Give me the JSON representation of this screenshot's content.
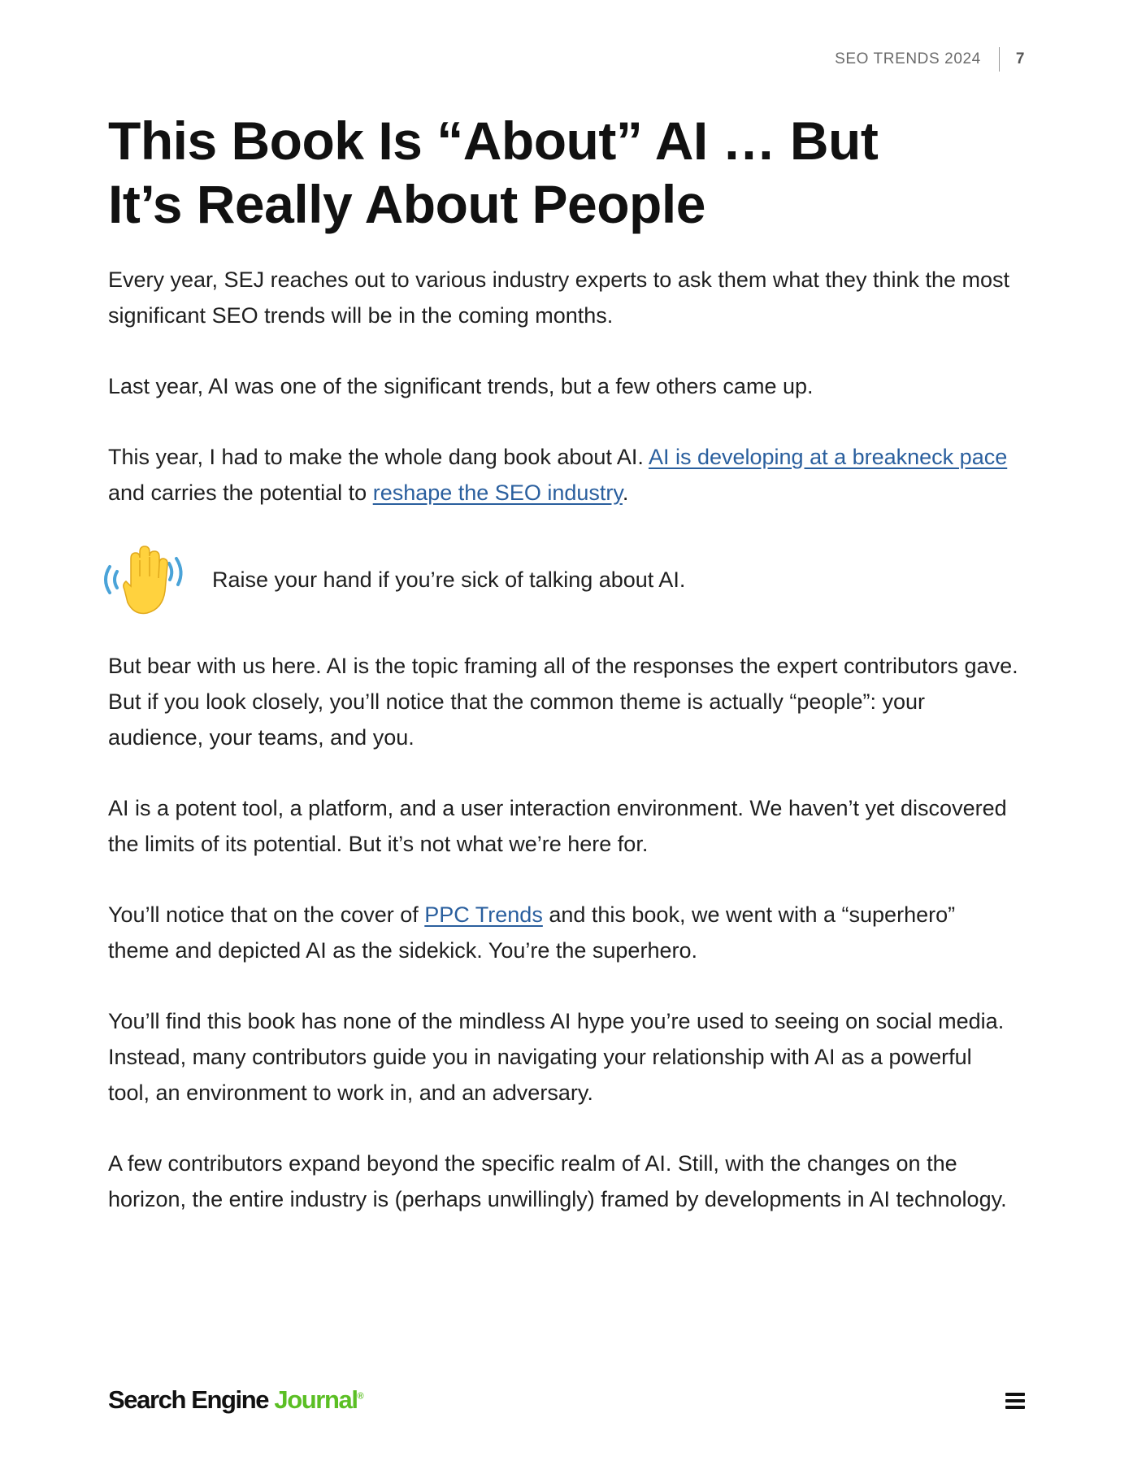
{
  "header": {
    "section_label": "SEO TRENDS 2024",
    "page_number": "7"
  },
  "title": {
    "line1": "This Book Is “About” AI … But",
    "line2": "It’s Really About People"
  },
  "paragraphs": {
    "p1": "Every year, SEJ reaches out to various industry experts to ask them what they think the most significant SEO trends will be in the coming months.",
    "p2": "Last year, AI was one of the significant trends, but a few others came up.",
    "p3": {
      "part1": "This year, I had to make the whole dang book about AI. ",
      "link1": "AI is developing at a breakneck pace",
      "part2": " and carries the potential to ",
      "link2": "reshape the SEO industry",
      "part3": "."
    },
    "callout": {
      "icon": "raised-hand-emoji",
      "text": "Raise your hand if you’re sick of talking about AI."
    },
    "p4": "But bear with us here. AI is the topic framing all of the responses the expert contributors gave. But if you look closely, you’ll notice that the common theme is actually “people”: your audience, your teams, and you.",
    "p5": "AI is a potent tool, a platform, and a user interaction environment. We haven’t yet discovered the limits of its potential. But it’s not what we’re here for.",
    "p6": {
      "part1": "You’ll notice that on the cover of ",
      "link1": "PPC Trends",
      "part2": " and this book, we went with a “superhero” theme and depicted AI as the sidekick. You’re the superhero."
    },
    "p7": "You’ll find this book has none of the mindless AI hype you’re used to seeing on social media. Instead, many contributors guide you in navigating your relationship with AI as a powerful tool, an environment to work in, and an adversary.",
    "p8": "A few contributors expand beyond the specific realm of AI. Still, with the changes on the horizon, the entire industry is (perhaps unwillingly) framed by developments in AI technology."
  },
  "footer": {
    "logo_part1": "Search Engine ",
    "logo_part2": "Journal",
    "logo_reg": "®",
    "menu_icon": "hamburger-menu-icon"
  },
  "colors": {
    "link": "#2a5f9e",
    "brand_green": "#5bbf24",
    "text": "#1f1f1f"
  }
}
